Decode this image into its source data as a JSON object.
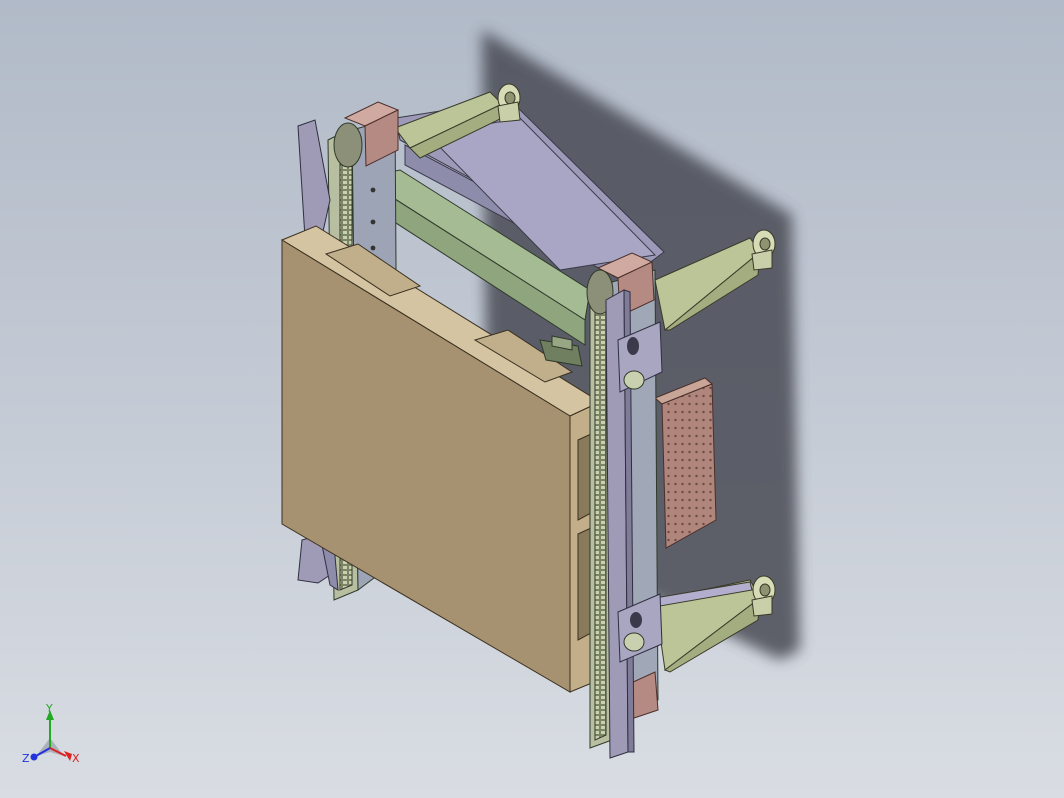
{
  "viewport": {
    "background_top": "#b1bac8",
    "background_bottom": "#d9dde3"
  },
  "colors": {
    "pallet_front": "#a69270",
    "pallet_top": "#d5c4a2",
    "pallet_side": "#c2ae89",
    "frame_green": "#a5bb94",
    "frame_purple": "#9c9ab8",
    "bracket_green": "#bcc597",
    "end_block_brown": "#b58a82",
    "strap_purple": "#9f9bb6",
    "panel_brown": "#b38c7e",
    "shadow": "#4a4c55"
  },
  "triad": {
    "x_label": "X",
    "y_label": "Y",
    "z_label": "Z",
    "x_color": "#dd2222",
    "y_color": "#22aa22",
    "z_color": "#2233dd"
  }
}
